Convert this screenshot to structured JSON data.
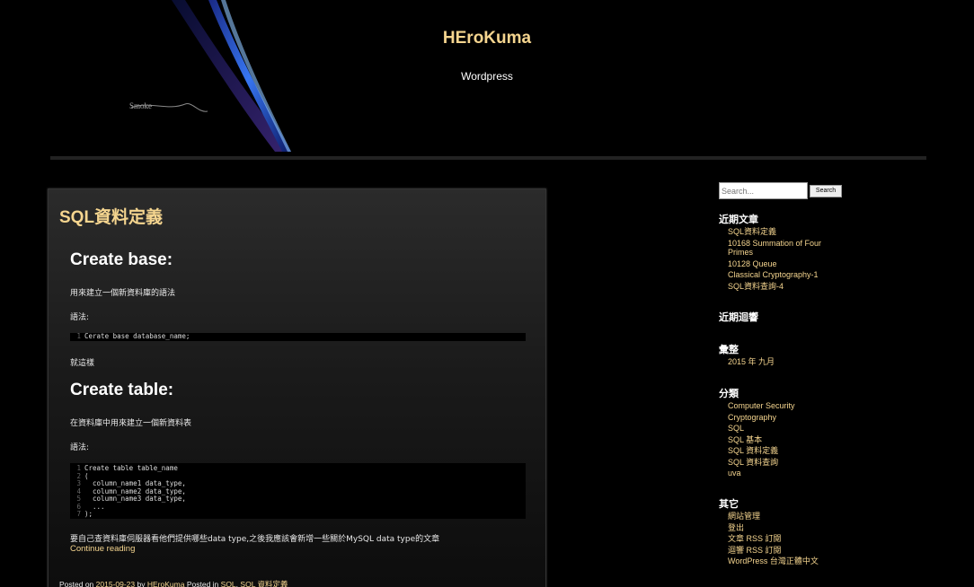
{
  "header": {
    "site_title": "HEroKuma",
    "site_description": "Wordpress",
    "banner_text": "Smoke"
  },
  "post": {
    "title": "SQL資料定義",
    "sections": [
      {
        "heading": "Create base:",
        "intro": "用來建立一個新資料庫的語法",
        "syntax_label": "語法:",
        "code": [
          {
            "n": "1",
            "t": "Cerate base database_name;"
          }
        ],
        "after": "就這樣"
      },
      {
        "heading": "Create table:",
        "intro": "在資料庫中用來建立一個新資料表",
        "syntax_label": "語法:",
        "code": [
          {
            "n": "1",
            "t": "Create table table_name"
          },
          {
            "n": "2",
            "t": "("
          },
          {
            "n": "3",
            "t": "  column_name1 data_type,"
          },
          {
            "n": "4",
            "t": "  column_name2 data_type,"
          },
          {
            "n": "5",
            "t": "  column_name3 data_type,"
          },
          {
            "n": "6",
            "t": "  ..."
          },
          {
            "n": "7",
            "t": ");"
          }
        ],
        "after": "要自己查資料庫伺服器看他們提供哪些data type,之後我應該會新增一些關於MySQL data type的文章"
      }
    ],
    "continue_label": "Continue reading",
    "meta": {
      "posted_on_label": "Posted on",
      "date": "2015-09-23",
      "by_label": "by",
      "author": "HEroKuma",
      "posted_in_label": "Posted in",
      "cat1": "SQL",
      "separator": ",",
      "cat2": "SQL 資料定義"
    }
  },
  "sidebar": {
    "search": {
      "placeholder": "Search...",
      "button_label": "Search"
    },
    "recent_posts": {
      "title": "近期文章",
      "items": [
        "SQL資料定義",
        "10168 Summation of Four Primes",
        "10128 Queue",
        "Classical Cryptography-1",
        "SQL資料查詢-4"
      ]
    },
    "recent_comments": {
      "title": "近期迴響"
    },
    "archives": {
      "title": "彙整",
      "items": [
        "2015 年 九月"
      ]
    },
    "categories": {
      "title": "分類",
      "items": [
        "Computer Security",
        "Cryptography",
        "SQL",
        "SQL 基本",
        "SQL 資料定義",
        "SQL 資料查詢",
        "uva"
      ]
    },
    "meta": {
      "title": "其它",
      "items": [
        "網站管理",
        "登出",
        "文章 RSS 訂閱",
        "迴響 RSS 訂閱",
        "WordPress 台灣正體中文"
      ]
    }
  },
  "colors": {
    "accent": "#f5d58f",
    "background": "#000000"
  }
}
